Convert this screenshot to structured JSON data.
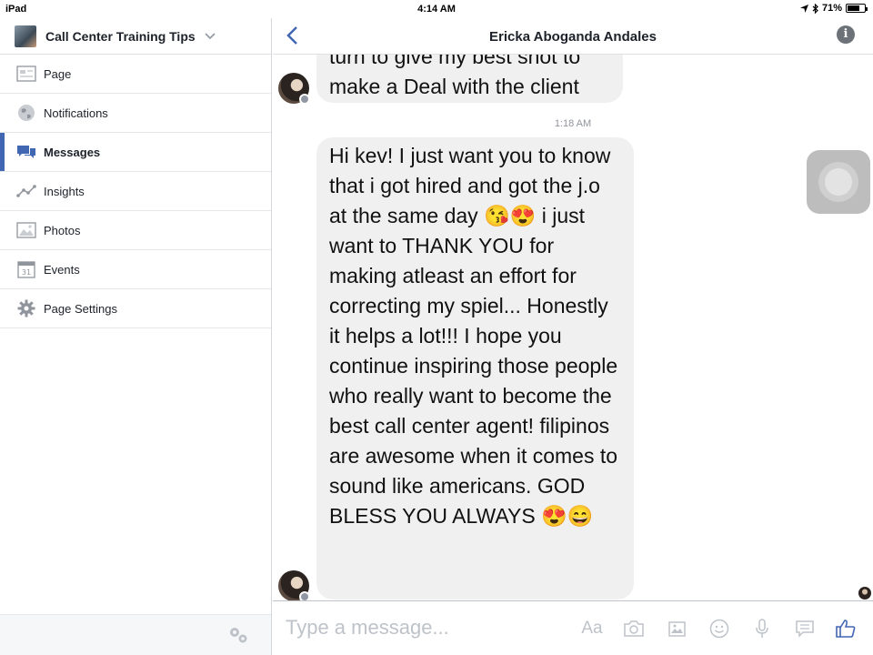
{
  "status_bar": {
    "device": "iPad",
    "time": "4:14 AM",
    "battery": "71%",
    "battery_level": 0.71
  },
  "sidebar": {
    "page_name": "Call Center Training Tips",
    "items": [
      {
        "label": "Page",
        "icon": "page-icon"
      },
      {
        "label": "Notifications",
        "icon": "globe-icon"
      },
      {
        "label": "Messages",
        "icon": "messages-icon",
        "active": true
      },
      {
        "label": "Insights",
        "icon": "insights-icon"
      },
      {
        "label": "Photos",
        "icon": "photos-icon"
      },
      {
        "label": "Events",
        "icon": "calendar-icon",
        "day": "31"
      },
      {
        "label": "Page Settings",
        "icon": "gear-icon"
      }
    ]
  },
  "conversation": {
    "title": "Ericka Aboganda Andales",
    "messages": [
      {
        "lines": [
          "turn to give my best shot to",
          "make a Deal with the client"
        ]
      },
      {
        "timestamp": "1:18 AM",
        "text": "Hi kev! I just want you to know that i got hired and got the j.o at the same day 😘😍 i just want to THANK YOU for making atleast an effort for correcting my spiel... Honestly it helps a lot!!! I hope you continue inspiring those people who really want to become the best call center agent! filipinos are awesome when it comes to sound like americans. GOD BLESS YOU ALWAYS 😍😄"
      }
    ]
  },
  "composer": {
    "placeholder": "Type a message...",
    "text_format_label": "Aa"
  },
  "colors": {
    "accent": "#4267b2",
    "bubble": "#f1f0f0",
    "muted": "#bec3c9"
  }
}
